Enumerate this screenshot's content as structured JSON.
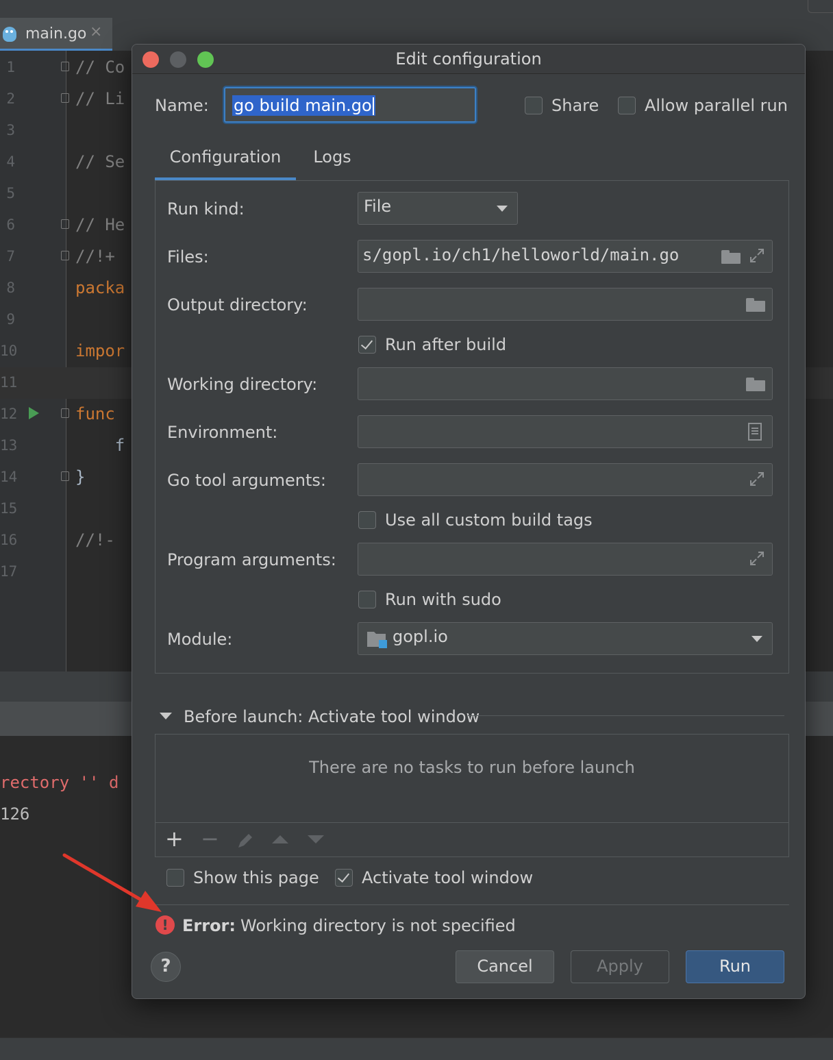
{
  "editor_tab": {
    "filename": "main.go",
    "close": "×"
  },
  "editor_lines": [
    {
      "n": "1",
      "code": "// Co",
      "cls": "c-comment"
    },
    {
      "n": "2",
      "code": "// Li",
      "cls": "c-comment"
    },
    {
      "n": "3",
      "code": "",
      "cls": "c-plain"
    },
    {
      "n": "4",
      "code": "// Se",
      "cls": "c-comment"
    },
    {
      "n": "5",
      "code": "",
      "cls": "c-plain"
    },
    {
      "n": "6",
      "code": "// He",
      "cls": "c-comment"
    },
    {
      "n": "7",
      "code": "//!+",
      "cls": "c-comment"
    },
    {
      "n": "8",
      "code": "packa",
      "cls": "c-kw"
    },
    {
      "n": "9",
      "code": "",
      "cls": "c-plain"
    },
    {
      "n": "10",
      "code": "impor",
      "cls": "c-kw"
    },
    {
      "n": "11",
      "code": "",
      "cls": "c-plain"
    },
    {
      "n": "12",
      "code": "func",
      "cls": "c-kw"
    },
    {
      "n": "13",
      "code": "    f",
      "cls": "c-plain"
    },
    {
      "n": "14",
      "code": "}",
      "cls": "c-plain"
    },
    {
      "n": "15",
      "code": "",
      "cls": "c-plain"
    },
    {
      "n": "16",
      "code": "//!-",
      "cls": "c-comment"
    },
    {
      "n": "17",
      "code": "",
      "cls": "c-plain"
    }
  ],
  "console": {
    "line1": "rectory '' d",
    "line2": "126"
  },
  "dialog": {
    "title": "Edit configuration",
    "name_label": "Name:",
    "name_value": "go build main.go",
    "share_label": "Share",
    "allow_parallel_label": "Allow parallel run",
    "tabs": {
      "configuration": "Configuration",
      "logs": "Logs"
    },
    "run_kind_label": "Run kind:",
    "run_kind_value": "File",
    "files_label": "Files:",
    "files_value": "s/gopl.io/ch1/helloworld/main.go",
    "output_dir_label": "Output directory:",
    "output_dir_value": "",
    "run_after_build_label": "Run after build",
    "run_after_build_checked": true,
    "working_dir_label": "Working directory:",
    "working_dir_value": "",
    "environment_label": "Environment:",
    "environment_value": "",
    "go_tool_args_label": "Go tool arguments:",
    "go_tool_args_value": "",
    "use_custom_tags_label": "Use all custom build tags",
    "program_args_label": "Program arguments:",
    "program_args_value": "",
    "run_with_sudo_label": "Run with sudo",
    "module_label": "Module:",
    "module_value": "gopl.io",
    "before_launch_label": "Before launch: Activate tool window",
    "no_tasks_text": "There are no tasks to run before launch",
    "toolbar": {
      "add": "+",
      "remove": "−"
    },
    "show_this_page_label": "Show this page",
    "activate_tool_window_label": "Activate tool window",
    "error_prefix": "Error:",
    "error_message": "Working directory is not specified",
    "help": "?",
    "cancel": "Cancel",
    "apply": "Apply",
    "run": "Run"
  },
  "colors": {
    "accent": "#4a88c7",
    "error": "#e0494b",
    "annotation_arrow": "#e0372b"
  },
  "icons": [
    "gopher-icon",
    "close-icon",
    "fold-icon",
    "run-gutter-icon",
    "chevron-down-icon",
    "folder-icon",
    "expand-icon",
    "document-icon",
    "module-folder-icon",
    "plus-icon",
    "minus-icon",
    "pencil-icon",
    "arrow-up-icon",
    "arrow-down-icon",
    "error-icon",
    "help-icon"
  ]
}
